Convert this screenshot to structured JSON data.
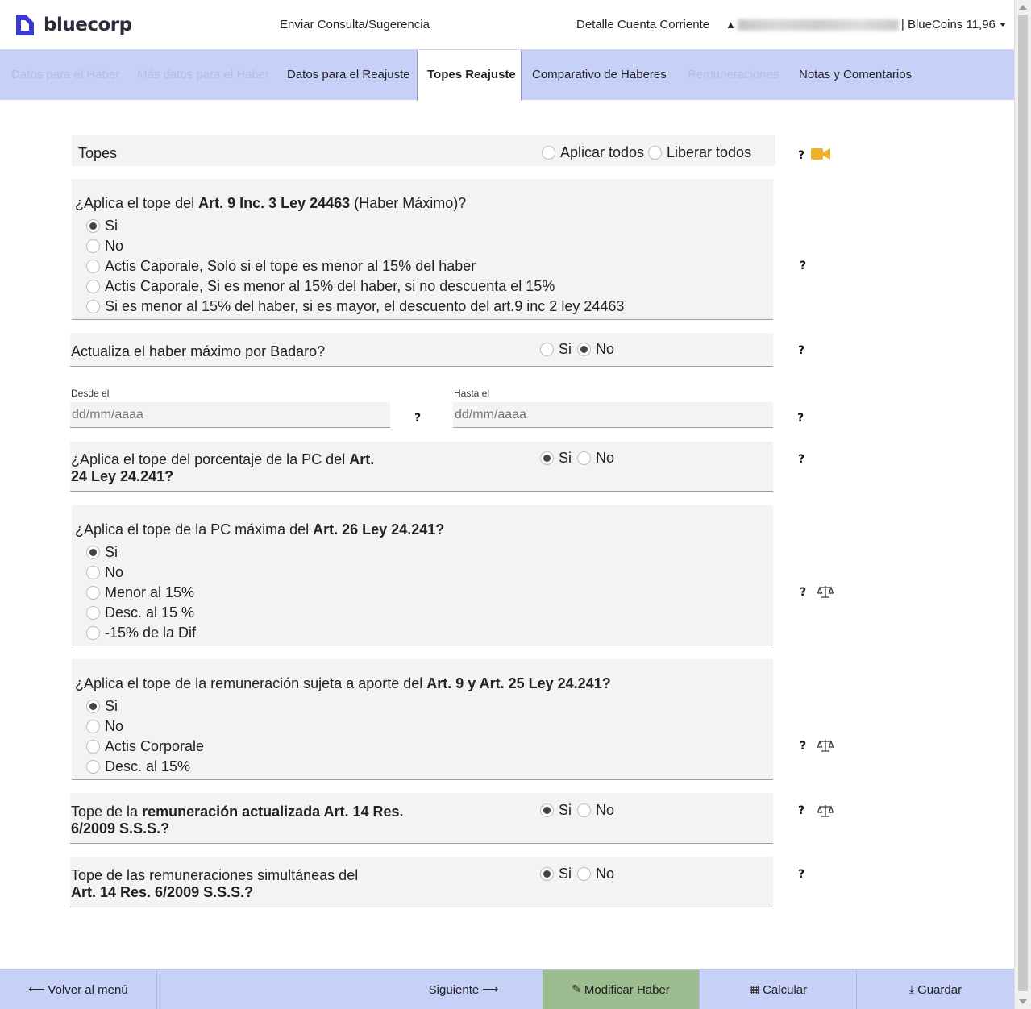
{
  "header": {
    "logo_text": "bluecorp",
    "consulta": "Enviar Consulta/Sugerencia",
    "cuenta": "Detalle Cuenta Corriente",
    "user_suffix": "| BlueCoins 11,96"
  },
  "tabs": [
    {
      "label": "Datos para el Haber"
    },
    {
      "label": "Más datos para el Haber"
    },
    {
      "label": "Datos para el Reajuste"
    },
    {
      "label": "Topes Reajuste"
    },
    {
      "label": "Comparativo de Haberes"
    },
    {
      "label": "Remuneraciones"
    },
    {
      "label": "Notas y Comentarios"
    }
  ],
  "topes": {
    "title": "Topes",
    "aplicar": "Aplicar todos",
    "liberar": "Liberar todos",
    "help": "?"
  },
  "q1": {
    "pre": "¿Aplica el tope del ",
    "bold": "Art. 9 Inc. 3 Ley 24463",
    "post": " (Haber Máximo)?",
    "options": [
      "Si",
      "No",
      "Actis Caporale, Solo si el tope es menor al 15% del haber",
      "Actis Caporale, Si es menor al 15% del haber, si no descuenta el 15%",
      "Si es menor al 15% del haber, si es mayor, el descuento del art.9 inc 2 ley 24463"
    ],
    "selected": 0
  },
  "q2": {
    "text": "Actualiza el haber máximo por Badaro?",
    "si": "Si",
    "no": "No",
    "selected": "no"
  },
  "dates": {
    "desde_label": "Desde el",
    "hasta_label": "Hasta el",
    "desde_placeholder": "dd/mm/aaaa",
    "hasta_placeholder": "dd/mm/aaaa"
  },
  "q3": {
    "pre": "¿Aplica el tope del porcentaje de la PC del ",
    "bold1": "Art.",
    "bold2": "24 Ley 24.241?",
    "si": "Si",
    "no": "No",
    "selected": "si"
  },
  "q4": {
    "pre": "¿Aplica el tope de la PC máxima del ",
    "bold": "Art. 26 Ley 24.241?",
    "options": [
      "Si",
      "No",
      "Menor al 15%",
      "Desc. al 15 %",
      "-15% de la Dif"
    ],
    "selected": 0
  },
  "q5": {
    "pre": "¿Aplica el tope de la remuneración sujeta a aporte del ",
    "bold": "Art. 9 y Art. 25 Ley 24.241?",
    "options": [
      "Si",
      "No",
      "Actis Corporale",
      "Desc. al 15%"
    ],
    "selected": 0
  },
  "q6": {
    "pre": "Tope de la ",
    "bold1": "remuneración actualizada Art. 14 Res.",
    "bold2": "6/2009 S.S.S.?",
    "si": "Si",
    "no": "No",
    "selected": "si"
  },
  "q7": {
    "line1": "Tope de las remuneraciones simultáneas del",
    "bold2": "Art. 14 Res. 6/2009 S.S.S.?",
    "si": "Si",
    "no": "No",
    "selected": "si"
  },
  "footer": {
    "volver": "Volver al menú",
    "siguiente": "Siguiente",
    "modificar": "Modificar Haber",
    "calcular": "Calcular",
    "guardar": "Guardar"
  },
  "colors": {
    "tab_bar": "#c7d0f7",
    "modificar_bg": "#9bbd8f",
    "camera_icon": "#f0b12a",
    "logo": "#3a3ad0"
  }
}
